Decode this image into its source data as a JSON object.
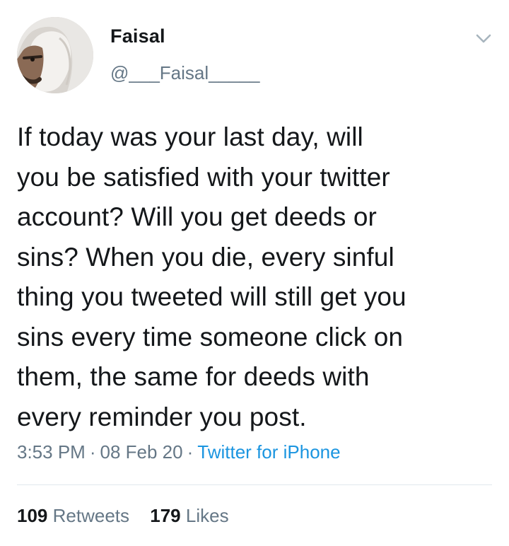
{
  "user": {
    "name": "Faisal",
    "handle": "@___Faisal_____"
  },
  "tweet": {
    "text": "If today was your last day, will\nyou be satisfied with your twitter\naccount? Will you get deeds or\nsins? When you die, every sinful\nthing you tweeted will still get you\nsins every time someone click on\nthem, the same for deeds with\nevery reminder you post.",
    "time": "3:53 PM",
    "date": "08 Feb 20",
    "source": "Twitter for iPhone",
    "separator": "·"
  },
  "stats": {
    "retweets_count": "109",
    "retweets_label": "Retweets",
    "likes_count": "179",
    "likes_label": "Likes"
  },
  "icons": {
    "menu": "chevron-down-icon"
  },
  "colors": {
    "text": "#14171a",
    "secondary": "#657786",
    "link": "#1b95e0",
    "divider": "#e1e8ed"
  }
}
